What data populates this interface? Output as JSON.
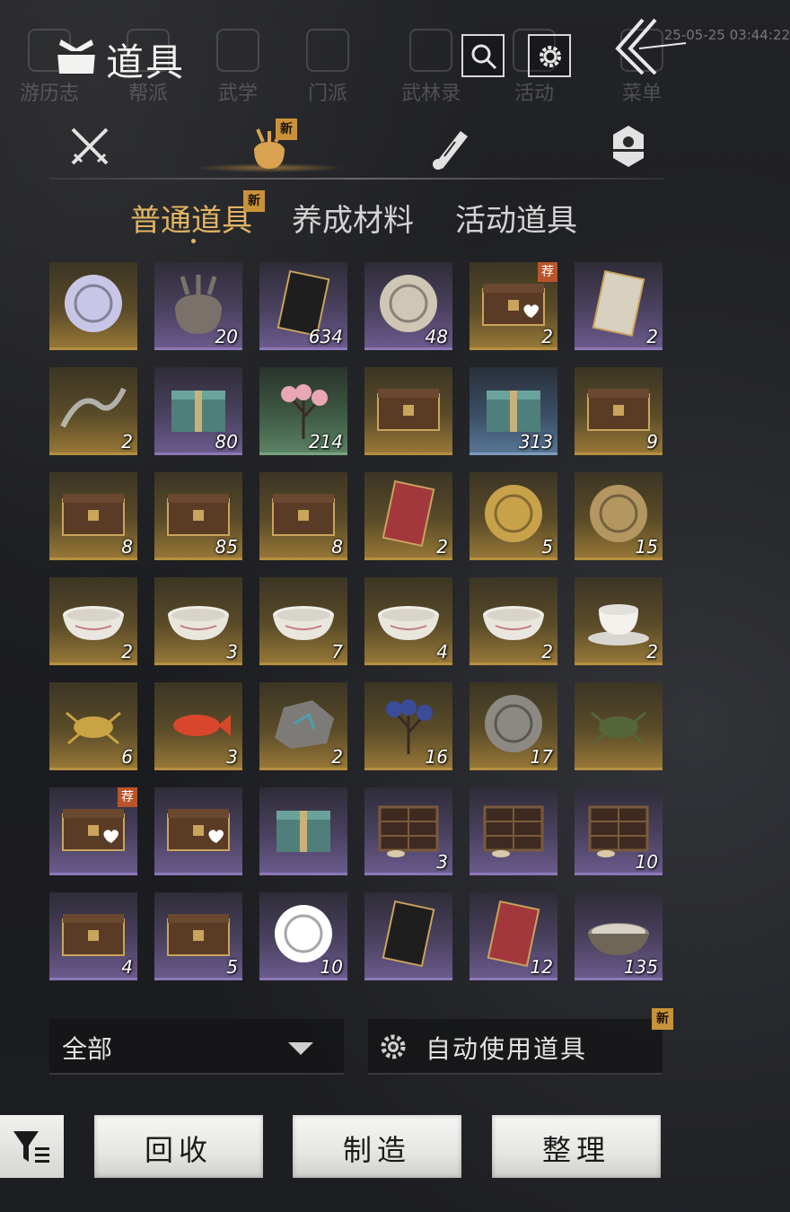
{
  "background": {
    "nav_items": [
      "游历志",
      "帮派",
      "武学",
      "门派",
      "武林录",
      "活动",
      "菜单"
    ],
    "timestamp": "25-05-25 03:44:22"
  },
  "header": {
    "title": "道具",
    "icons": [
      "bag-icon",
      "search-icon",
      "settings-icon",
      "back-arrow-icon"
    ]
  },
  "category_tabs": [
    {
      "icon": "crossed-swords-icon",
      "active": false
    },
    {
      "icon": "pouch-icon",
      "active": true,
      "badge": "新"
    },
    {
      "icon": "scroll-icon",
      "active": false
    },
    {
      "icon": "token-icon",
      "active": false
    }
  ],
  "sub_tabs": [
    {
      "label": "普通道具",
      "active": true,
      "badge": "新"
    },
    {
      "label": "养成材料",
      "active": false
    },
    {
      "label": "活动道具",
      "active": false
    }
  ],
  "items": [
    {
      "icon": "crystal-orb-icon",
      "rarity": "gold",
      "count": ""
    },
    {
      "icon": "cloth-sack-icon",
      "rarity": "purple",
      "count": "20"
    },
    {
      "icon": "black-envelope-icon",
      "rarity": "purple",
      "count": "634"
    },
    {
      "icon": "dove-medallion-icon",
      "rarity": "purple",
      "count": "48"
    },
    {
      "icon": "gift-chest-heart-icon",
      "rarity": "gold",
      "count": "2",
      "badge": "荐"
    },
    {
      "icon": "paper-letter-icon",
      "rarity": "purple",
      "count": "2"
    },
    {
      "icon": "glass-dragon-icon",
      "rarity": "gold",
      "count": "2"
    },
    {
      "icon": "gift-box-icon",
      "rarity": "purple",
      "count": "80"
    },
    {
      "icon": "plum-blossom-icon",
      "rarity": "green",
      "count": "214"
    },
    {
      "icon": "wooden-chest-icon",
      "rarity": "gold",
      "count": ""
    },
    {
      "icon": "dye-box-icon",
      "rarity": "blue",
      "count": "313"
    },
    {
      "icon": "chest-shell-icon",
      "rarity": "gold",
      "count": "9"
    },
    {
      "icon": "chest-jade-icon",
      "rarity": "gold",
      "count": "8"
    },
    {
      "icon": "chest-ore-icon",
      "rarity": "gold",
      "count": "85"
    },
    {
      "icon": "chest-robe-icon",
      "rarity": "gold",
      "count": "8"
    },
    {
      "icon": "red-book-icon",
      "rarity": "gold",
      "count": "2"
    },
    {
      "icon": "gold-bell-icon",
      "rarity": "gold",
      "count": "5"
    },
    {
      "icon": "cat-coin-icon",
      "rarity": "gold",
      "count": "15"
    },
    {
      "icon": "pink-bowl-icon",
      "rarity": "gold",
      "count": "2"
    },
    {
      "icon": "lotus-bowl-icon",
      "rarity": "gold",
      "count": "3"
    },
    {
      "icon": "floral-bowl-icon",
      "rarity": "gold",
      "count": "7"
    },
    {
      "icon": "rooster-bowl-icon",
      "rarity": "gold",
      "count": "4"
    },
    {
      "icon": "plain-bowl-icon",
      "rarity": "gold",
      "count": "2"
    },
    {
      "icon": "lidded-cup-icon",
      "rarity": "gold",
      "count": "2"
    },
    {
      "icon": "golden-beetle-icon",
      "rarity": "gold",
      "count": "6"
    },
    {
      "icon": "red-fish-icon",
      "rarity": "gold",
      "count": "3"
    },
    {
      "icon": "ore-stone-icon",
      "rarity": "gold",
      "count": "2"
    },
    {
      "icon": "blue-flower-icon",
      "rarity": "gold",
      "count": "16"
    },
    {
      "icon": "stone-egg-icon",
      "rarity": "gold",
      "count": "17"
    },
    {
      "icon": "cricket-icon",
      "rarity": "gold",
      "count": ""
    },
    {
      "icon": "gift-chest-heart-icon",
      "rarity": "purple",
      "count": "",
      "badge": "荐"
    },
    {
      "icon": "gift-chest-heart-icon",
      "rarity": "purple",
      "count": ""
    },
    {
      "icon": "wrapped-gift-icon",
      "rarity": "purple",
      "count": ""
    },
    {
      "icon": "shelf-cabinet-icon",
      "rarity": "purple",
      "count": "3"
    },
    {
      "icon": "shelf-cabinet-icon",
      "rarity": "purple",
      "count": ""
    },
    {
      "icon": "shelf-cabinet-icon",
      "rarity": "purple",
      "count": "10"
    },
    {
      "icon": "small-chest-icon",
      "rarity": "purple",
      "count": "4"
    },
    {
      "icon": "iron-chest-icon",
      "rarity": "purple",
      "count": "5"
    },
    {
      "icon": "mountain-emblem-icon",
      "rarity": "purple",
      "count": "10"
    },
    {
      "icon": "black-token-icon",
      "rarity": "purple",
      "count": ""
    },
    {
      "icon": "red-card-icon",
      "rarity": "purple",
      "count": "12"
    },
    {
      "icon": "powder-bowl-icon",
      "rarity": "purple",
      "count": "135"
    }
  ],
  "controls": {
    "filter_value": "全部",
    "auto_use_label": "自动使用道具",
    "auto_use_badge": "新",
    "buttons": [
      "回收",
      "制造",
      "整理"
    ]
  }
}
